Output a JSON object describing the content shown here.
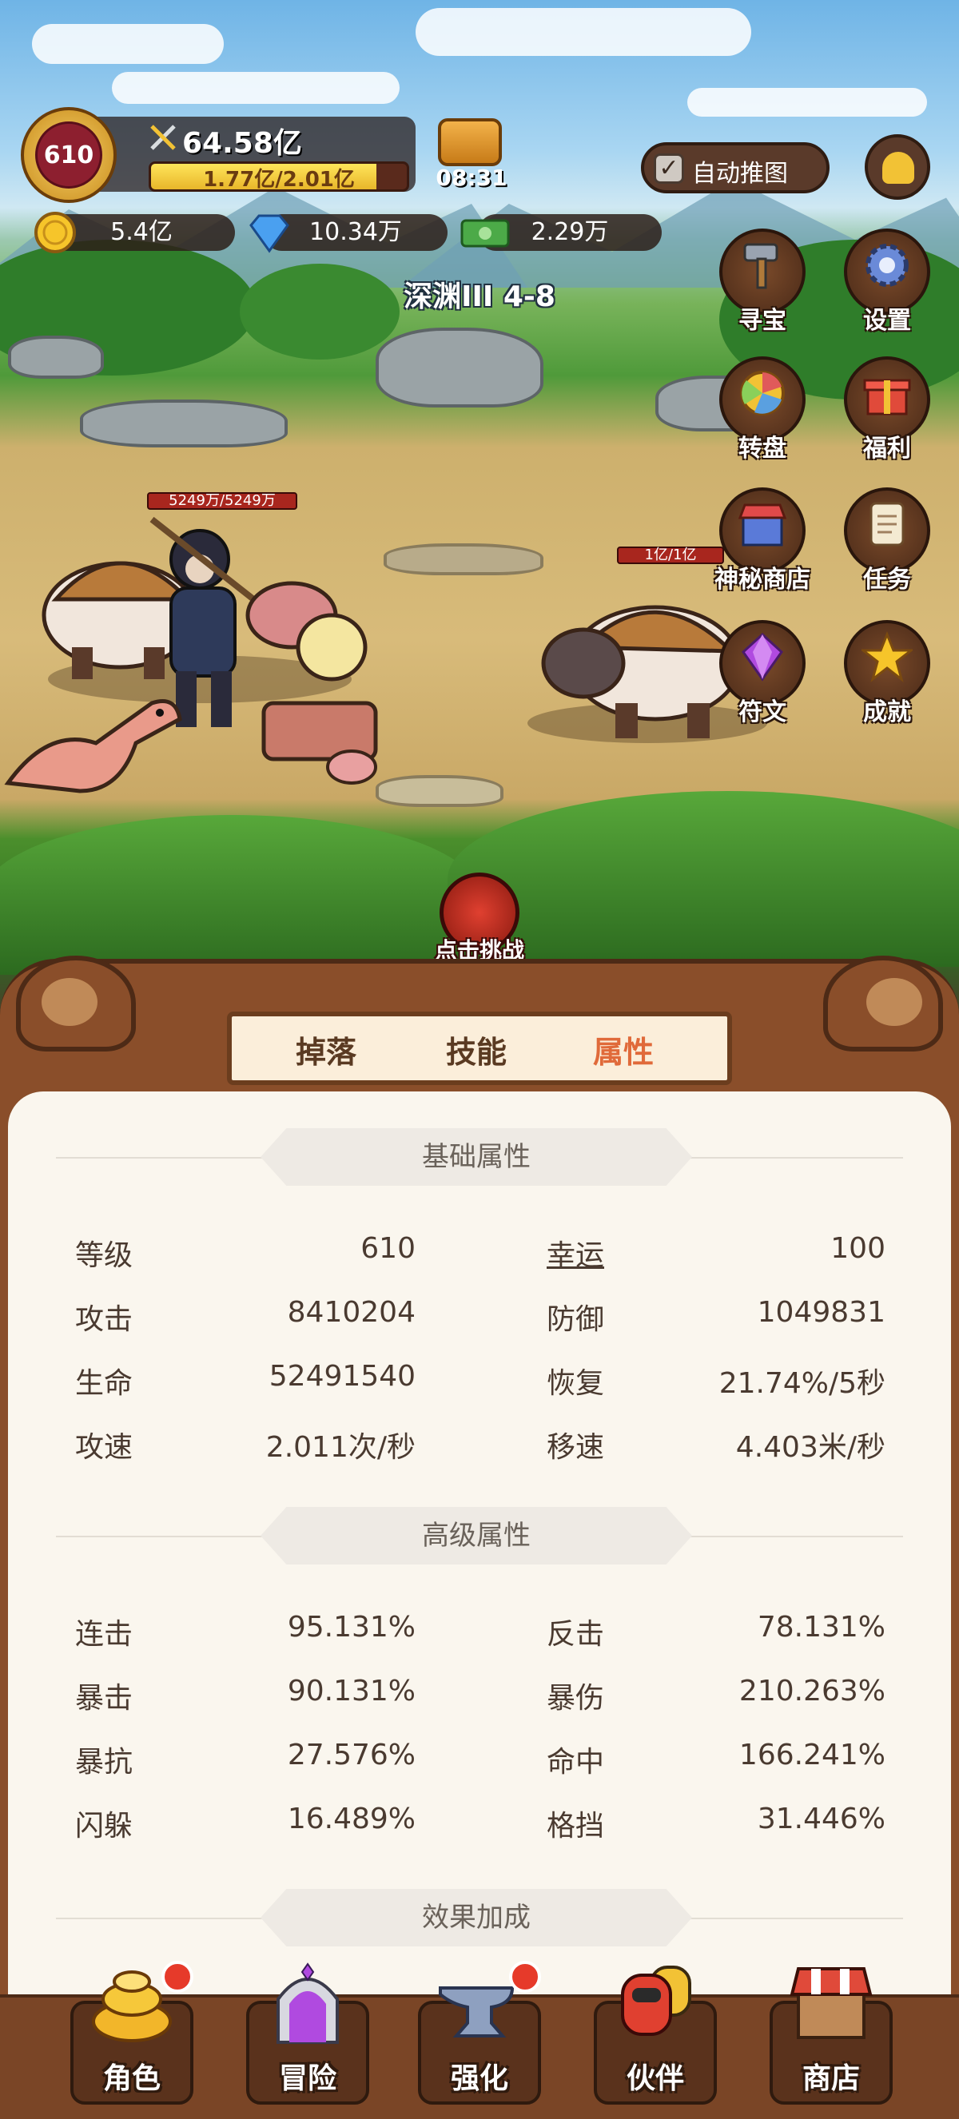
{
  "player": {
    "level_badge": "610",
    "power": "64.58亿",
    "exp_text": "1.77亿/2.01亿",
    "exp_progress": 0.88,
    "timer": "08:31"
  },
  "auto_push": {
    "label": "自动推图",
    "checked": true
  },
  "resources": {
    "gold": "5.4亿",
    "diamond": "10.34万",
    "cash": "2.29万"
  },
  "stage": {
    "name": "深渊III 4-8"
  },
  "side_menu": [
    {
      "label": "寻宝",
      "icon": "hammer-icon"
    },
    {
      "label": "设置",
      "icon": "gear-icon"
    },
    {
      "label": "转盘",
      "icon": "wheel-icon"
    },
    {
      "label": "福利",
      "icon": "gift-icon"
    },
    {
      "label": "神秘商店",
      "icon": "shop-icon"
    },
    {
      "label": "任务",
      "icon": "scroll-icon"
    },
    {
      "label": "符文",
      "icon": "gem-icon"
    },
    {
      "label": "成就",
      "icon": "star-icon"
    }
  ],
  "battle": {
    "hero_hp": "5249万/5249万",
    "hero_hp_fraction": 1.0,
    "enemy_hp": "1亿/1亿",
    "enemy_hp_fraction": 1.0,
    "challenge_label": "点击挑战"
  },
  "tabs": [
    {
      "label": "掉落",
      "active": false
    },
    {
      "label": "技能",
      "active": false
    },
    {
      "label": "属性",
      "active": true
    }
  ],
  "sections": {
    "basic": {
      "title": "基础属性",
      "stats": [
        {
          "label": "等级",
          "value": "610"
        },
        {
          "label": "幸运",
          "value": "100"
        },
        {
          "label": "攻击",
          "value": "8410204"
        },
        {
          "label": "防御",
          "value": "1049831"
        },
        {
          "label": "生命",
          "value": "52491540"
        },
        {
          "label": "恢复",
          "value": "21.74%/5秒"
        },
        {
          "label": "攻速",
          "value": "2.011次/秒"
        },
        {
          "label": "移速",
          "value": "4.403米/秒"
        }
      ]
    },
    "advanced": {
      "title": "高级属性",
      "stats": [
        {
          "label": "连击",
          "value": "95.131%"
        },
        {
          "label": "反击",
          "value": "78.131%"
        },
        {
          "label": "暴击",
          "value": "90.131%"
        },
        {
          "label": "暴伤",
          "value": "210.263%"
        },
        {
          "label": "暴抗",
          "value": "27.576%"
        },
        {
          "label": "命中",
          "value": "166.241%"
        },
        {
          "label": "闪躲",
          "value": "16.489%"
        },
        {
          "label": "格挡",
          "value": "31.446%"
        }
      ]
    },
    "effects": {
      "title": "效果加成"
    }
  },
  "bottom_nav": [
    {
      "label": "角色",
      "icon": "gold-pile-icon",
      "badge": true
    },
    {
      "label": "冒险",
      "icon": "portal-icon",
      "badge": false
    },
    {
      "label": "强化",
      "icon": "anvil-icon",
      "badge": true
    },
    {
      "label": "伙伴",
      "icon": "companion-icon",
      "badge": false
    },
    {
      "label": "商店",
      "icon": "store-icon",
      "badge": false
    }
  ],
  "colors": {
    "panel_bg": "#faf6ee",
    "frame_brown": "#8a4e2a",
    "active_tab": "#e06a3a",
    "text": "#4a3a30",
    "badge_red": "#e63a2a"
  }
}
